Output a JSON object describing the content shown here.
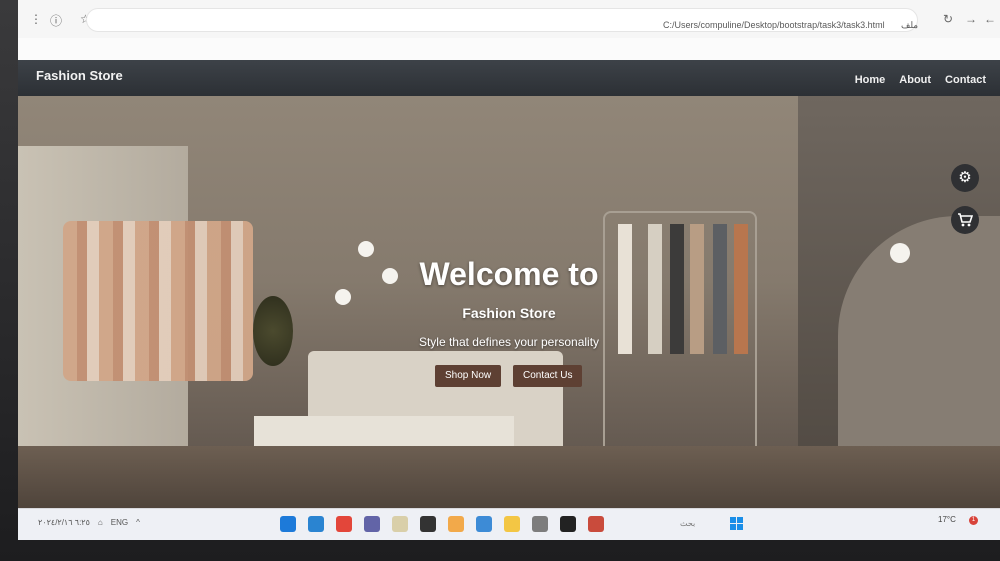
{
  "browser": {
    "url": "C:/Users/compuline/Desktop/bootstrap/task3/task3.html",
    "site_badge": "ملف"
  },
  "navbar": {
    "brand": "Fashion Store",
    "links": [
      "Home",
      "About",
      "Contact"
    ]
  },
  "hero": {
    "title": "Welcome to",
    "subtitle": "Fashion Store",
    "tagline": "Style that defines your personality",
    "primary_button": "Shop Now",
    "secondary_button": "Contact Us"
  },
  "floating_buttons": {
    "settings_icon": "gear-icon",
    "cart_icon": "cart-icon"
  },
  "taskbar": {
    "date_time": "٦:٢٥ ٢٠٢٤/٢/١٦",
    "lang": "ENG",
    "search_placeholder": "بحث",
    "weather": "17°C",
    "notification_count": "1"
  },
  "colors": {
    "navbar": "#2f3338",
    "button": "#5e4033",
    "hero_text": "#ffffff"
  }
}
